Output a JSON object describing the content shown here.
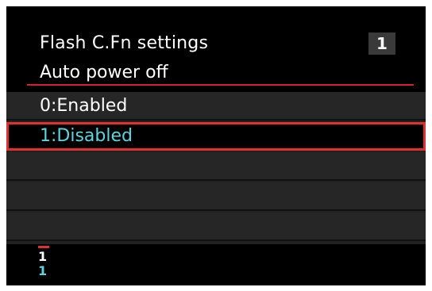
{
  "header": {
    "title": "Flash C.Fn settings",
    "page_number": "1",
    "subtitle": "Auto power off"
  },
  "options": [
    {
      "label": "0:Enabled",
      "selected": false
    },
    {
      "label": "1:Disabled",
      "selected": true
    },
    {
      "label": "",
      "selected": false
    },
    {
      "label": "",
      "selected": false
    },
    {
      "label": "",
      "selected": false
    }
  ],
  "legend": {
    "current_value": "1",
    "setting_value": "1"
  },
  "colors": {
    "accent_red": "#e03030",
    "selected_text_cyan": "#5ad6e0",
    "background": "#000000"
  }
}
